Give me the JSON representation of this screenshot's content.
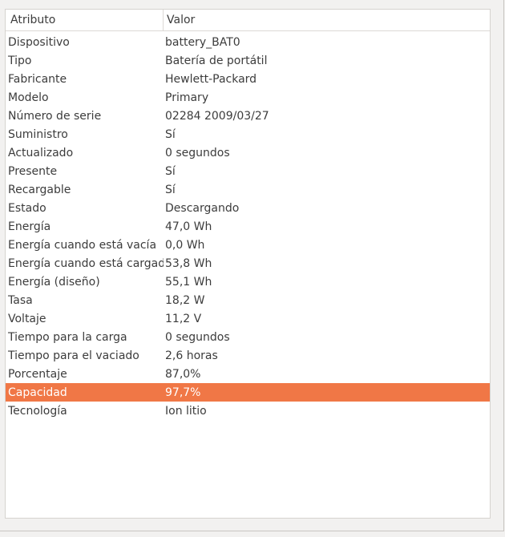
{
  "columns": {
    "attribute": "Atributo",
    "value": "Valor"
  },
  "colors": {
    "selection": "#f07746"
  },
  "rows": [
    {
      "label": "Dispositivo",
      "value": "battery_BAT0"
    },
    {
      "label": "Tipo",
      "value": "Batería de portátil"
    },
    {
      "label": "Fabricante",
      "value": "Hewlett-Packard"
    },
    {
      "label": "Modelo",
      "value": "Primary"
    },
    {
      "label": "Número de serie",
      "value": "02284 2009/03/27"
    },
    {
      "label": "Suministro",
      "value": "Sí"
    },
    {
      "label": "Actualizado",
      "value": "0 segundos"
    },
    {
      "label": "Presente",
      "value": "Sí"
    },
    {
      "label": "Recargable",
      "value": "Sí"
    },
    {
      "label": "Estado",
      "value": "Descargando"
    },
    {
      "label": "Energía",
      "value": "47,0 Wh"
    },
    {
      "label": "Energía cuando está vacía",
      "value": "0,0 Wh"
    },
    {
      "label": "Energía cuando está cargada",
      "value": "53,8 Wh"
    },
    {
      "label": "Energía (diseño)",
      "value": "55,1 Wh"
    },
    {
      "label": "Tasa",
      "value": "18,2 W"
    },
    {
      "label": "Voltaje",
      "value": "11,2 V"
    },
    {
      "label": "Tiempo para la carga",
      "value": "0 segundos"
    },
    {
      "label": "Tiempo para el vaciado",
      "value": "2,6 horas"
    },
    {
      "label": "Porcentaje",
      "value": "87,0%"
    },
    {
      "label": "Capacidad",
      "value": "97,7%",
      "selected": true
    },
    {
      "label": "Tecnología",
      "value": "Ion litio"
    }
  ]
}
